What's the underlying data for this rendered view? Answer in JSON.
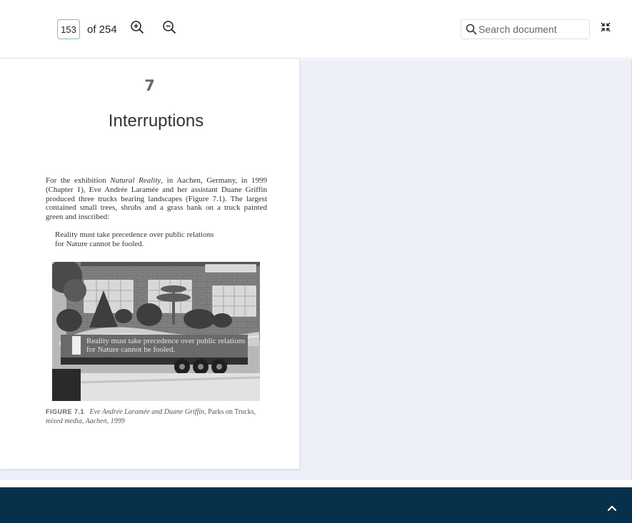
{
  "toolbar": {
    "page_current": "153",
    "page_total_text": "of 254",
    "zoom_in_icon": "zoom-in-icon",
    "zoom_out_icon": "zoom-out-icon",
    "search_placeholder": "Search document",
    "search_icon": "search-icon",
    "collapse_icon": "collapse-icon"
  },
  "page": {
    "chapter_number": "7",
    "chapter_title": "Interruptions",
    "body_lead": "For the exhibition ",
    "body_italic": "Natural Reality",
    "body_rest": ", in Aachen, Germany, in 1999 (Chapter 1), Eve Andrée Laramée and her assistant Duane Griffin produced three trucks bearing landscapes (Figure 7.1). The largest contained small trees, shrubs and a grass bank on a truck painted green and inscribed:",
    "quote_line1": "Reality must take precedence over public relations",
    "quote_line2": "for Nature cannot be fooled.",
    "figure_truck_text1": "Reality must take precedence over public relations",
    "figure_truck_text2": "for Nature cannot be fooled.",
    "caption_label": "FIGURE 7.1",
    "caption_italic1": "Eve Andrée Laramée and Duane Griffin",
    "caption_roman": ", Parks on Trucks,",
    "caption_italic2": "mixed media, Aachen, 1999"
  },
  "footer": {
    "scroll_up_icon": "chevron-up-icon"
  },
  "colors": {
    "footer_bg": "#07304a",
    "viewer_bg": "#edf0f8",
    "page_input_border": "#8fb7b5"
  }
}
